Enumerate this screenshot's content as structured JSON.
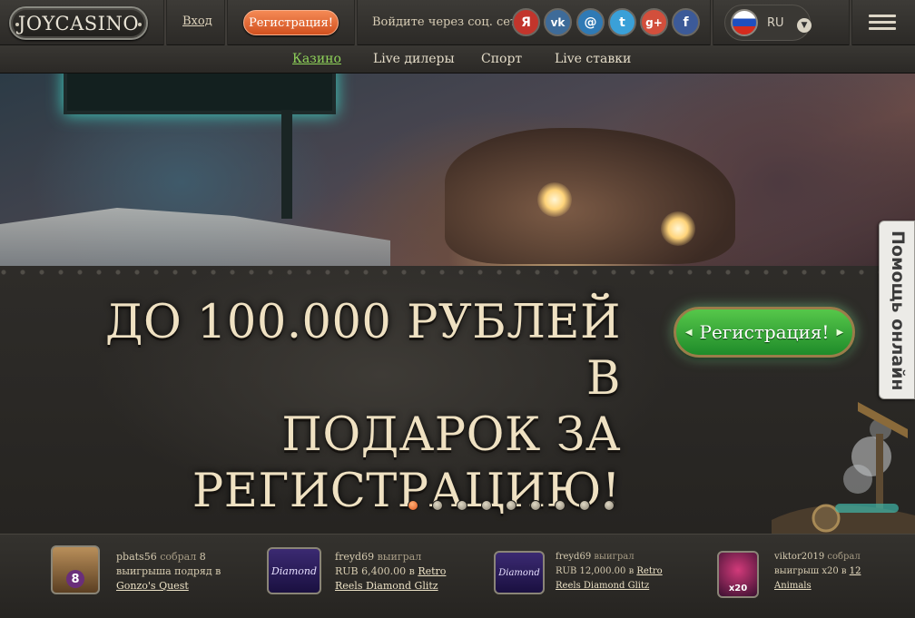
{
  "header": {
    "logo": "JOYCASINO",
    "login": "Вход",
    "register": "Регистрация!",
    "social_label": "Войдите через соц. сети:",
    "social": [
      {
        "name": "yandex",
        "glyph": "Я",
        "color": "#c2352c"
      },
      {
        "name": "vk",
        "glyph": "vk",
        "color": "#3e6b99"
      },
      {
        "name": "mail",
        "glyph": "@",
        "color": "#2f7ab5"
      },
      {
        "name": "twitter",
        "glyph": "t",
        "color": "#3aa0d8"
      },
      {
        "name": "google-plus",
        "glyph": "g+",
        "color": "#d24f3c"
      },
      {
        "name": "facebook",
        "glyph": "f",
        "color": "#3c5a98"
      }
    ],
    "language": "RU"
  },
  "nav": {
    "items": [
      {
        "label": "Казино",
        "active": true
      },
      {
        "label": "Live дилеры",
        "active": false
      },
      {
        "label": "Спорт",
        "active": false
      },
      {
        "label": "Live ставки",
        "active": false
      }
    ]
  },
  "promo": {
    "line1": "ДО 100.000 РУБЛЕЙ В",
    "line2": "ПОДАРОК ЗА",
    "line3": "РЕГИСТРАЦИЮ!",
    "register_button": "Регистрация!",
    "slides_count": 9,
    "active_slide": 0
  },
  "help_tab": "Помощь онлайн",
  "winners": [
    {
      "user": "pbats56",
      "action": "собрал",
      "amount": "8",
      "desc": "выигрыша подряд в",
      "game": "Gonzo's Quest",
      "thumb_badge": "8"
    },
    {
      "user": "freyd69",
      "action": "выиграл",
      "amount": "RUB 6,400.00",
      "desc": "в",
      "game": "Retro Reels Diamond Glitz",
      "thumb_badge": "Diamond"
    },
    {
      "user": "freyd69",
      "action": "выиграл",
      "amount": "RUB 12,000.00",
      "desc": "в",
      "game": "Retro Reels Diamond Glitz",
      "thumb_badge": "Diamond"
    },
    {
      "user": "viktor2019",
      "action": "собрал",
      "amount": "",
      "desc": "выигрыш x20 в",
      "game": "12 Animals",
      "thumb_badge": "x20"
    }
  ]
}
